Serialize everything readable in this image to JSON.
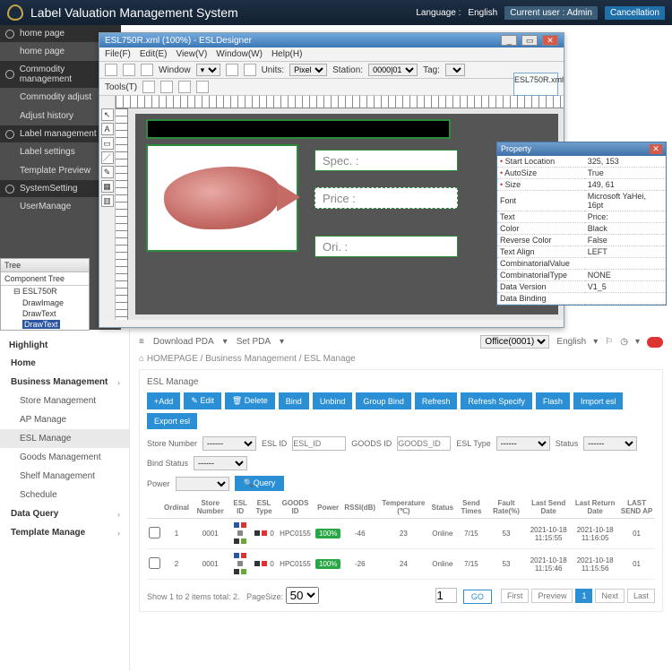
{
  "header": {
    "title": "Label Valuation Management System",
    "language_label": "Language :",
    "language_value": "English",
    "current_user_label": "Current user :",
    "current_user_value": "Admin",
    "cancel": "Cancellation"
  },
  "leftnav": {
    "groups": [
      {
        "label": "home page",
        "items": [
          {
            "label": "home page"
          }
        ]
      },
      {
        "label": "Commodity management",
        "items": [
          {
            "label": "Commodity adjust"
          },
          {
            "label": "Adjust history"
          }
        ]
      },
      {
        "label": "Label management",
        "items": [
          {
            "label": "Label settings"
          },
          {
            "label": "Template Preview"
          }
        ]
      },
      {
        "label": "SystemSetting",
        "items": [
          {
            "label": "UserManage"
          }
        ]
      }
    ]
  },
  "tree": {
    "title": "Tree",
    "subtitle": "Component Tree",
    "root": "ESL750R",
    "nodes": [
      "DrawImage",
      "DrawText",
      "DrawText"
    ],
    "selected_index": 2
  },
  "designer": {
    "title": "ESL750R.xml (100%) - ESLDesigner",
    "menu": [
      "File(F)",
      "Edit(E)",
      "View(V)",
      "Window(W)",
      "Help(H)"
    ],
    "toolbar": {
      "window_label": "Window",
      "units_label": "Units:",
      "units_value": "Pixel",
      "station_label": "Station:",
      "station_value": "0000|01",
      "tag_label": "Tag:",
      "tools_label": "Tools(T)"
    },
    "floating_file": "ESL750R.xml",
    "fields": {
      "spec": "Spec. :",
      "price": "Price :",
      "ori": "Ori. :"
    }
  },
  "property": {
    "title": "Property",
    "rows": [
      {
        "k": "Start Location",
        "v": "325, 153"
      },
      {
        "k": "AutoSize",
        "v": "True"
      },
      {
        "k": "Size",
        "v": "149, 61"
      },
      {
        "k": "Font",
        "v": "Microsoft YaHei, 16pt"
      },
      {
        "k": "Text",
        "v": "Price:"
      },
      {
        "k": "Color",
        "v": "Black"
      },
      {
        "k": "Reverse Color",
        "v": "False"
      },
      {
        "k": "Text Align",
        "v": "LEFT"
      },
      {
        "k": "CombinatorialValue",
        "v": ""
      },
      {
        "k": "CombinatorialType",
        "v": "NONE"
      },
      {
        "k": "Data Version",
        "v": "V1_5"
      },
      {
        "k": "Data Binding",
        "v": ""
      }
    ]
  },
  "lower_side": {
    "highlight": "Highlight",
    "items": [
      {
        "label": "Home",
        "cat": true
      },
      {
        "label": "Business Management",
        "cat": true,
        "chev": true
      },
      {
        "label": "Store Management"
      },
      {
        "label": "AP Manage"
      },
      {
        "label": "ESL Manage",
        "active": true
      },
      {
        "label": "Goods Management"
      },
      {
        "label": "Shelf Management"
      },
      {
        "label": "Schedule"
      },
      {
        "label": "Data Query",
        "cat": true,
        "chev": true
      },
      {
        "label": "Template Manage",
        "cat": true,
        "chev": true
      }
    ]
  },
  "main2": {
    "topbar": {
      "download": "Download PDA",
      "setpda": "Set PDA",
      "office": "Office(0001)",
      "english": "English"
    },
    "breadcrumb": [
      "HOMEPAGE",
      "Business Management",
      "ESL Manage"
    ],
    "panel_title": "ESL Manage",
    "buttons": [
      "+Add",
      "✎ Edit",
      "🗑 Delete",
      "Bind",
      "Unbind",
      "Group Bind",
      "Refresh",
      "Refresh Specify",
      "Flash",
      "Import esl",
      "Export esl"
    ],
    "filters": {
      "store": "Store Number",
      "esl_id": "ESL ID",
      "esl_id_ph": "ESL_ID",
      "goods": "GOODS ID",
      "goods_ph": "GOODS_ID",
      "esl_type": "ESL Type",
      "status": "Status",
      "bind": "Bind Status",
      "power": "Power",
      "query": "🔍Query",
      "dash": "------"
    },
    "columns": [
      "",
      "Ordinal",
      "Store Number",
      "ESL ID",
      "ESL Type",
      "GOODS ID",
      "Power",
      "RSSI(dB)",
      "Temperature (℃)",
      "Status",
      "Send Times",
      "Fault Rate(%)",
      "Last Send Date",
      "Last Return Date",
      "LAST SEND AP"
    ],
    "rows": [
      {
        "ord": "1",
        "store": "0001",
        "eslid": "■ ■",
        "goods": "HPC0155",
        "power": "100%",
        "rssi": "-46",
        "temp": "23",
        "status": "Online",
        "send": "7/15",
        "fault": "53",
        "lsd": "2021-10-18 11:15:55",
        "lrd": "2021-10-18 11:16:05",
        "ap": "01"
      },
      {
        "ord": "2",
        "store": "0001",
        "eslid": "■ ■",
        "goods": "HPC0155",
        "power": "100%",
        "rssi": "-26",
        "temp": "24",
        "status": "Online",
        "send": "7/15",
        "fault": "53",
        "lsd": "2021-10-18 11:15:46",
        "lrd": "2021-10-18 11:15:56",
        "ap": "01"
      }
    ],
    "pager": {
      "summary": "Show 1 to 2 items total: 2.",
      "pagesize_label": "PageSize:",
      "pagesize": "50",
      "go": "GO",
      "first": "First",
      "prev": "Preview",
      "page": "1",
      "next": "Next",
      "last": "Last",
      "input": "1"
    }
  }
}
